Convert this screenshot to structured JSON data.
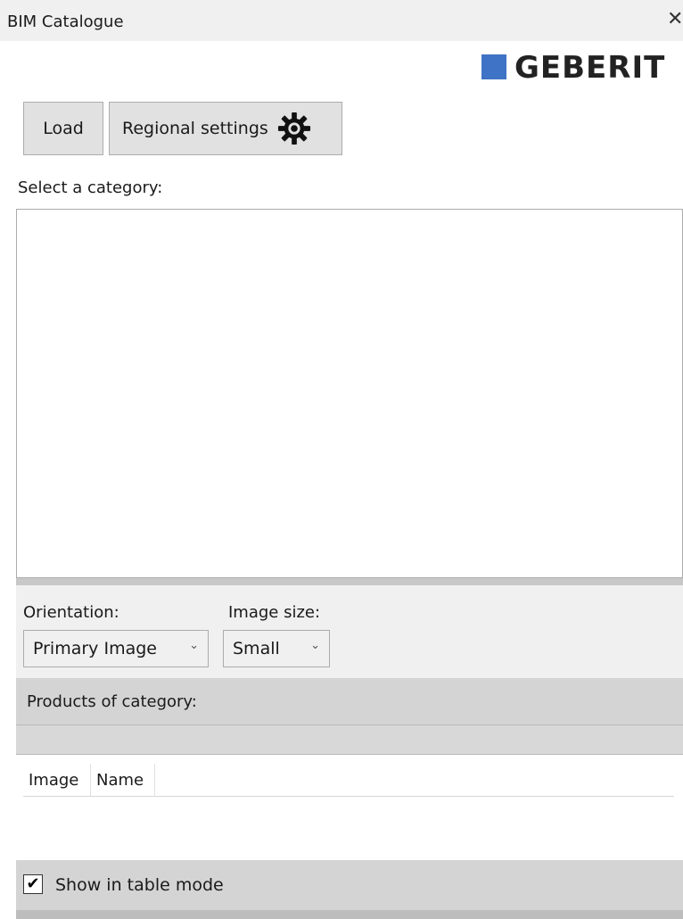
{
  "window": {
    "title": "BIM Catalogue",
    "close_glyph": "✕"
  },
  "brand": {
    "name": "GEBERIT",
    "accent_color": "#3f73c5"
  },
  "toolbar": {
    "load_label": "Load",
    "regional_label": "Regional settings",
    "regional_icon": "gear-icon"
  },
  "category": {
    "label": "Select a category:",
    "items": []
  },
  "orientation": {
    "label": "Orientation:",
    "value": "Primary Image"
  },
  "image_size": {
    "label": "Image size:",
    "value": "Small"
  },
  "products": {
    "header": "Products of category:",
    "columns": [
      "Image",
      "Name"
    ],
    "rows": []
  },
  "table_mode": {
    "label": "Show in table mode",
    "checked": true,
    "check_glyph": "✔"
  }
}
